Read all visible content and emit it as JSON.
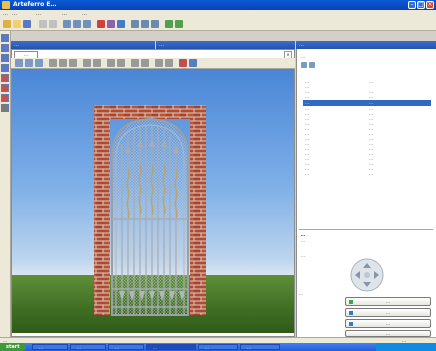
{
  "window": {
    "title": "Arteferro E…"
  },
  "menu": [
    "…",
    "…",
    "…",
    "…",
    "…"
  ],
  "panels": {
    "designer_title": "…",
    "designer_tab": "…",
    "view_title": "…",
    "properties_title": "…"
  },
  "properties": {
    "section_label": "…",
    "rows": [
      {
        "label": "…",
        "value": "…"
      },
      {
        "label": "…",
        "value": ""
      },
      {
        "label": "…",
        "value": "…"
      },
      {
        "label": "…",
        "value": "…"
      },
      {
        "label": "…",
        "value": "…"
      },
      {
        "label": "…",
        "value": "…"
      },
      {
        "label": "…",
        "value": "…"
      },
      {
        "label": "…",
        "value": "…"
      },
      {
        "label": "…",
        "value": "…"
      },
      {
        "label": "…",
        "value": "…"
      },
      {
        "label": "…",
        "value": "…"
      },
      {
        "label": "…",
        "value": "…"
      },
      {
        "label": "…",
        "value": "…"
      },
      {
        "label": "…",
        "value": "…"
      },
      {
        "label": "…",
        "value": "…"
      },
      {
        "label": "…",
        "value": "…"
      },
      {
        "label": "…",
        "value": "…"
      },
      {
        "label": "…",
        "value": "…"
      },
      {
        "label": "…",
        "value": "…"
      }
    ],
    "selected_index": 4,
    "description_title": "…",
    "description_text": "…",
    "nav_label": "…",
    "bottom_tab": "…",
    "buttons": [
      "…",
      "…",
      "…",
      "…"
    ]
  },
  "status": {
    "left_text": "…",
    "right_text": "…"
  },
  "taskbar": {
    "start_label": "start",
    "tasks": [
      "…",
      "…",
      "…",
      "…",
      "…",
      "…"
    ],
    "active_index": 3
  },
  "colors": {
    "brick": "#b04a32",
    "mortar": "#d8cfc0",
    "iron": "#9aa0a6",
    "accent": "#316ac5"
  }
}
